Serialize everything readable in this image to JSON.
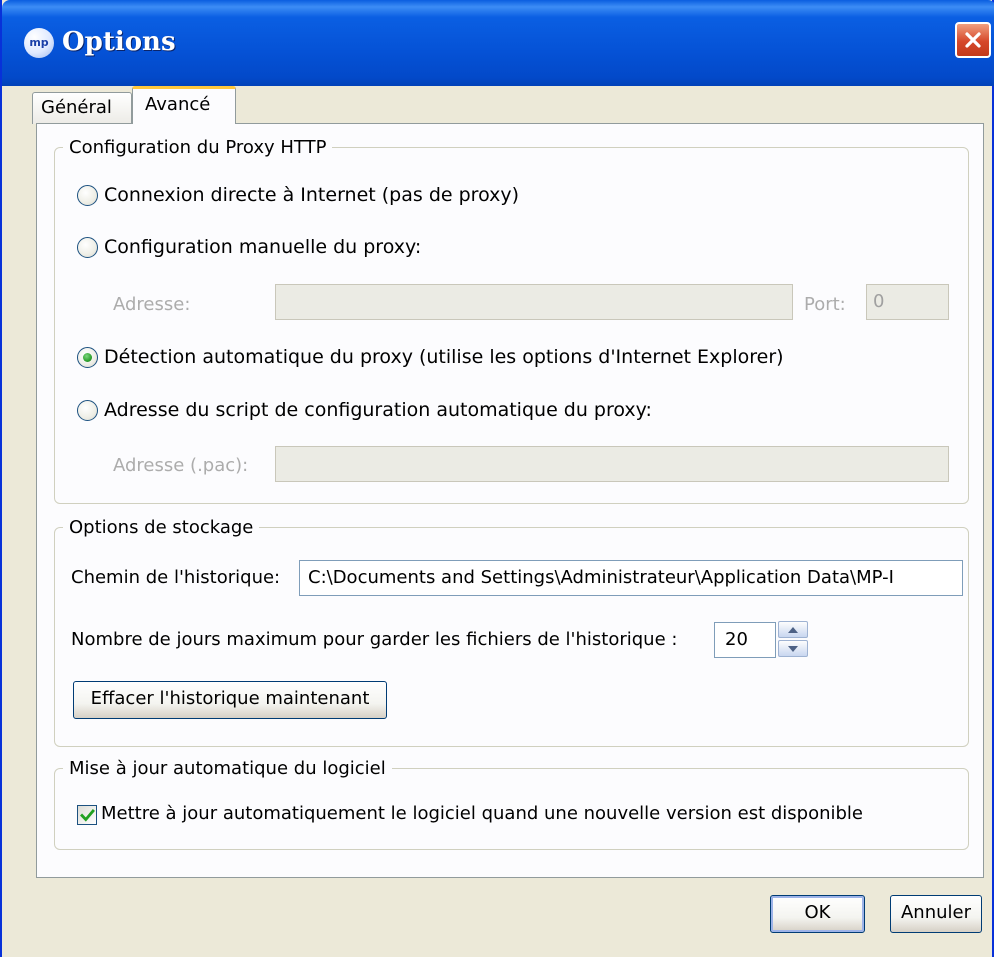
{
  "window": {
    "title": "Options",
    "logo_text": "mp"
  },
  "tabs": [
    {
      "label": "Général"
    },
    {
      "label": "Avancé"
    }
  ],
  "proxy": {
    "legend": "Configuration du Proxy HTTP",
    "options": [
      "Connexion directe à Internet (pas de proxy)",
      "Configuration manuelle du proxy:",
      "Détection automatique du proxy (utilise les options d'Internet Explorer)",
      "Adresse du script de configuration automatique du proxy:"
    ],
    "selected_index": 2,
    "address_label": "Adresse:",
    "address_value": "",
    "port_label": "Port:",
    "port_value": "0",
    "pac_label": "Adresse (.pac):",
    "pac_value": ""
  },
  "storage": {
    "legend": "Options de stockage",
    "history_path_label": "Chemin de l'historique:",
    "history_path_value": "C:\\Documents and Settings\\Administrateur\\Application Data\\MP-I",
    "max_days_label": "Nombre de jours maximum pour garder les fichiers de l'historique :",
    "max_days_value": "20",
    "clear_button": "Effacer l'historique maintenant"
  },
  "update": {
    "legend": "Mise à jour automatique du logiciel",
    "auto_update_label": "Mettre à jour automatiquement le logiciel quand une nouvelle version est disponible",
    "auto_update_checked": true
  },
  "buttons": {
    "ok": "OK",
    "cancel": "Annuler"
  },
  "colors": {
    "title_bar": "#0552d6",
    "dialog_bg": "#ece9d8",
    "tab_accent": "#ffc83c",
    "check": "#21a121"
  }
}
